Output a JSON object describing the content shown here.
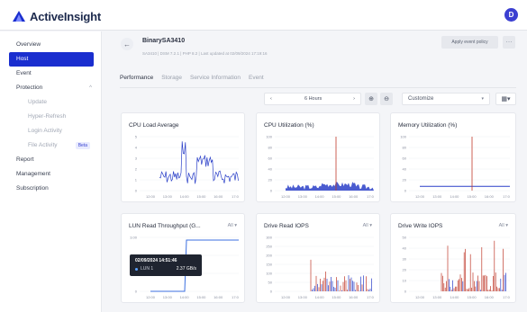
{
  "app": {
    "name": "ActiveInsight",
    "user_initial": "D",
    "accent": "#1a2ecf"
  },
  "sidebar": {
    "items": [
      {
        "label": "Overview",
        "type": "top"
      },
      {
        "label": "Host",
        "type": "top",
        "active": true
      },
      {
        "label": "Event",
        "type": "top"
      },
      {
        "label": "Protection",
        "type": "top",
        "expandable": true
      },
      {
        "label": "Update",
        "type": "sub"
      },
      {
        "label": "Hyper-Refresh",
        "type": "sub"
      },
      {
        "label": "Login Activity",
        "type": "sub"
      },
      {
        "label": "File Activity",
        "type": "sub",
        "badge": "Beta"
      },
      {
        "label": "Report",
        "type": "top"
      },
      {
        "label": "Management",
        "type": "top"
      },
      {
        "label": "Subscription",
        "type": "top"
      }
    ]
  },
  "host": {
    "name": "BinarySA3410",
    "meta": "SA3410 | DSM 7.2.1 | PHP 8.2 | Last updated at 02/09/2024 17:19:16",
    "apply_policy_label": "Apply event policy",
    "more_icon": "more-icon"
  },
  "tabs": [
    "Performance",
    "Storage",
    "Service Information",
    "Event"
  ],
  "toolbar": {
    "time_range": "6 Hours",
    "prev_icon": "‹",
    "next_icon": "›",
    "zoom_in_icon": "zoom-in-icon",
    "zoom_out_icon": "zoom-out-icon",
    "customize_label": "Customize",
    "layout_icon": "grid-icon"
  },
  "charts": {
    "cpu_load": {
      "title": "CPU Load Average",
      "yticks": [
        "5",
        "4",
        "3",
        "2",
        "1",
        "0"
      ],
      "color": "#2a3fc8"
    },
    "cpu_util": {
      "title": "CPU Utilization (%)",
      "yticks": [
        "100",
        "80",
        "60",
        "40",
        "20",
        "0"
      ],
      "color": "#2a3fc8",
      "marker_color": "#c0392b"
    },
    "mem_util": {
      "title": "Memory Utilization (%)",
      "yticks": [
        "100",
        "80",
        "60",
        "40",
        "20",
        "0"
      ],
      "color": "#2a3fc8",
      "marker_color": "#c0392b"
    },
    "lun_read": {
      "title": "LUN Read Throughput (G...",
      "filter": "All ▾",
      "yticks": [
        "3.00",
        "2.00",
        "1.00",
        "0"
      ],
      "color": "#3b6fe0"
    },
    "drive_read": {
      "title": "Drive Read IOPS",
      "filter": "All ▾",
      "yticks": [
        "300",
        "250",
        "200",
        "150",
        "100",
        "50",
        "0"
      ],
      "color": "#2a3fc8",
      "color2": "#c0392b"
    },
    "drive_write": {
      "title": "Drive Write IOPS",
      "filter": "All ▾",
      "yticks": [
        "50",
        "40",
        "30",
        "20",
        "10",
        "0"
      ],
      "color": "#c0392b",
      "color2": "#2a3fc8"
    }
  },
  "xticks": [
    "12:00",
    "13:00",
    "14:00",
    "15:00",
    "16:00",
    "17:0"
  ],
  "tooltip": {
    "time": "02/09/2024 14:51:46",
    "series": "LUN 1",
    "value": "2.37 GB/s"
  }
}
